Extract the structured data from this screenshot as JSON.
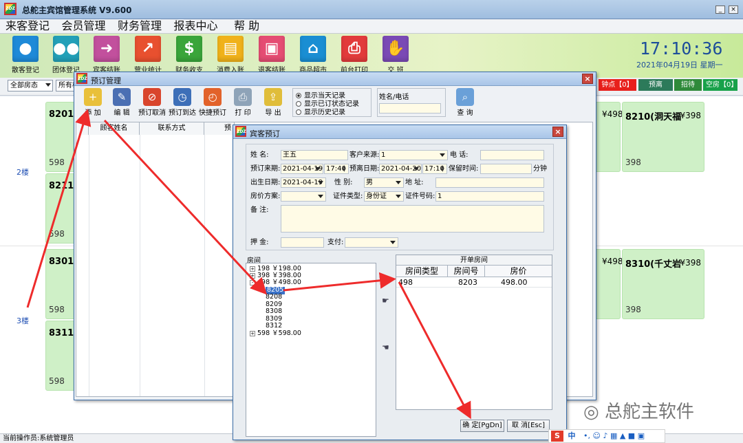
{
  "app": {
    "title": "总舵主宾馆管理系统  V9.600",
    "menu": [
      "来客登记",
      "会员管理",
      "财务管理",
      "报表中心",
      "帮 助"
    ],
    "toolbar": [
      {
        "label": "散客登记",
        "icon": "person-icon",
        "color": "#1e8ad8"
      },
      {
        "label": "团体登记",
        "icon": "group-icon",
        "color": "#23a0b8"
      },
      {
        "label": "宾客结账",
        "icon": "checkout-icon",
        "color": "#c2509d"
      },
      {
        "label": "营业统计",
        "icon": "stats-icon",
        "color": "#e8502f"
      },
      {
        "label": "财务收支",
        "icon": "money-icon",
        "color": "#3aa53a"
      },
      {
        "label": "消费入账",
        "icon": "register-icon",
        "color": "#f0b21a"
      },
      {
        "label": "退客结账",
        "icon": "wallet-icon",
        "color": "#e54d73"
      },
      {
        "label": "商品超市",
        "icon": "store-icon",
        "color": "#1a8ed3"
      },
      {
        "label": "前台打印",
        "icon": "printer-icon",
        "color": "#e23b3b"
      },
      {
        "label": "交  班",
        "icon": "handshake-icon",
        "color": "#7a4ab5"
      }
    ],
    "clock": "17:10:36",
    "date": "2021年04月19日  星期一",
    "filter_room_state": "全部房态",
    "filter_floor": "所有楼",
    "legend": [
      {
        "label": "钟点【0】",
        "color": "#e8201c"
      },
      {
        "label": "预离",
        "color": "#2c7a5a"
      },
      {
        "label": "招待",
        "color": "#2f8a3a"
      },
      {
        "label": "空房【0】",
        "color": "#18a14a"
      }
    ],
    "floors": [
      "2楼",
      "3楼"
    ],
    "rooms": [
      {
        "no": "8201(",
        "price": "598"
      },
      {
        "no": "8211(",
        "price": "598"
      },
      {
        "no": "8301(",
        "price": "598"
      },
      {
        "no": "8311(",
        "price": "598"
      },
      {
        "no": "8210(洞天福",
        "rate": "¥398",
        "price": "398"
      },
      {
        "no": "8310(千丈岩",
        "rate": "¥398",
        "price": "398"
      }
    ],
    "room_rates_right": [
      "¥498",
      "¥498"
    ],
    "status": "当前操作员:系统管理员"
  },
  "booking_mgmt": {
    "title": "预订管理",
    "buttons": [
      "添 加",
      "编 辑",
      "预订取消",
      "预订到达",
      "快捷预订",
      "打 印",
      "导 出"
    ],
    "radios": [
      "显示当天记录",
      "显示已订状态记录",
      "显示历史记录"
    ],
    "search_label": "姓名/电话",
    "search_value": "",
    "query_button": "查 询",
    "columns": [
      "顾客姓名",
      "联系方式",
      "预"
    ]
  },
  "guest_booking": {
    "title": "宾客预订",
    "labels": {
      "name": "姓    名:",
      "source": "客户来源:",
      "phone": "电    话:",
      "arrive": "预订来期:",
      "leave": "预离日期:",
      "hold": "保留时间:",
      "minutes": "分钟",
      "birth": "出生日期:",
      "gender": "性    别:",
      "address": "地    址:",
      "rate_plan": "房价方案:",
      "id_type": "证件类型:",
      "id_no": "证件号码:",
      "remark": "备    注:",
      "deposit": "押    金:",
      "pay": "支付:"
    },
    "values": {
      "name": "王五",
      "source": "1",
      "phone": "",
      "arrive_date": "2021-04-19",
      "arrive_time": "17:40",
      "leave_date": "2021-04-20",
      "leave_time": "17:10",
      "hold": "",
      "birth": "2021-04-19",
      "gender": "男",
      "address": "",
      "rate_plan": "",
      "id_type": "身份证",
      "id_no": "1",
      "remark": "",
      "deposit": "",
      "pay": ""
    },
    "tree_title": "房间",
    "tree": [
      {
        "text": "198 ￥198.00",
        "level": 0,
        "sign": "+"
      },
      {
        "text": "398 ￥398.00",
        "level": 0,
        "sign": "+"
      },
      {
        "text": "498 ￥498.00",
        "level": 0,
        "sign": "-"
      },
      {
        "text": "8205",
        "level": 1,
        "selected": true
      },
      {
        "text": "8208",
        "level": 1
      },
      {
        "text": "8209",
        "level": 1
      },
      {
        "text": "8308",
        "level": 1
      },
      {
        "text": "8309",
        "level": 1
      },
      {
        "text": "8312",
        "level": 1
      },
      {
        "text": "598 ￥598.00",
        "level": 0,
        "sign": "+"
      }
    ],
    "open_rooms_title": "开单房间",
    "open_cols": [
      "房间类型",
      "房间号",
      "房价"
    ],
    "open_rows": [
      [
        "498",
        "8203",
        "498.00"
      ]
    ],
    "ok_button": "确  定[PgDn]",
    "cancel_button": "取  消[Esc]"
  },
  "watermark": "总舵主软件",
  "ime": "中"
}
